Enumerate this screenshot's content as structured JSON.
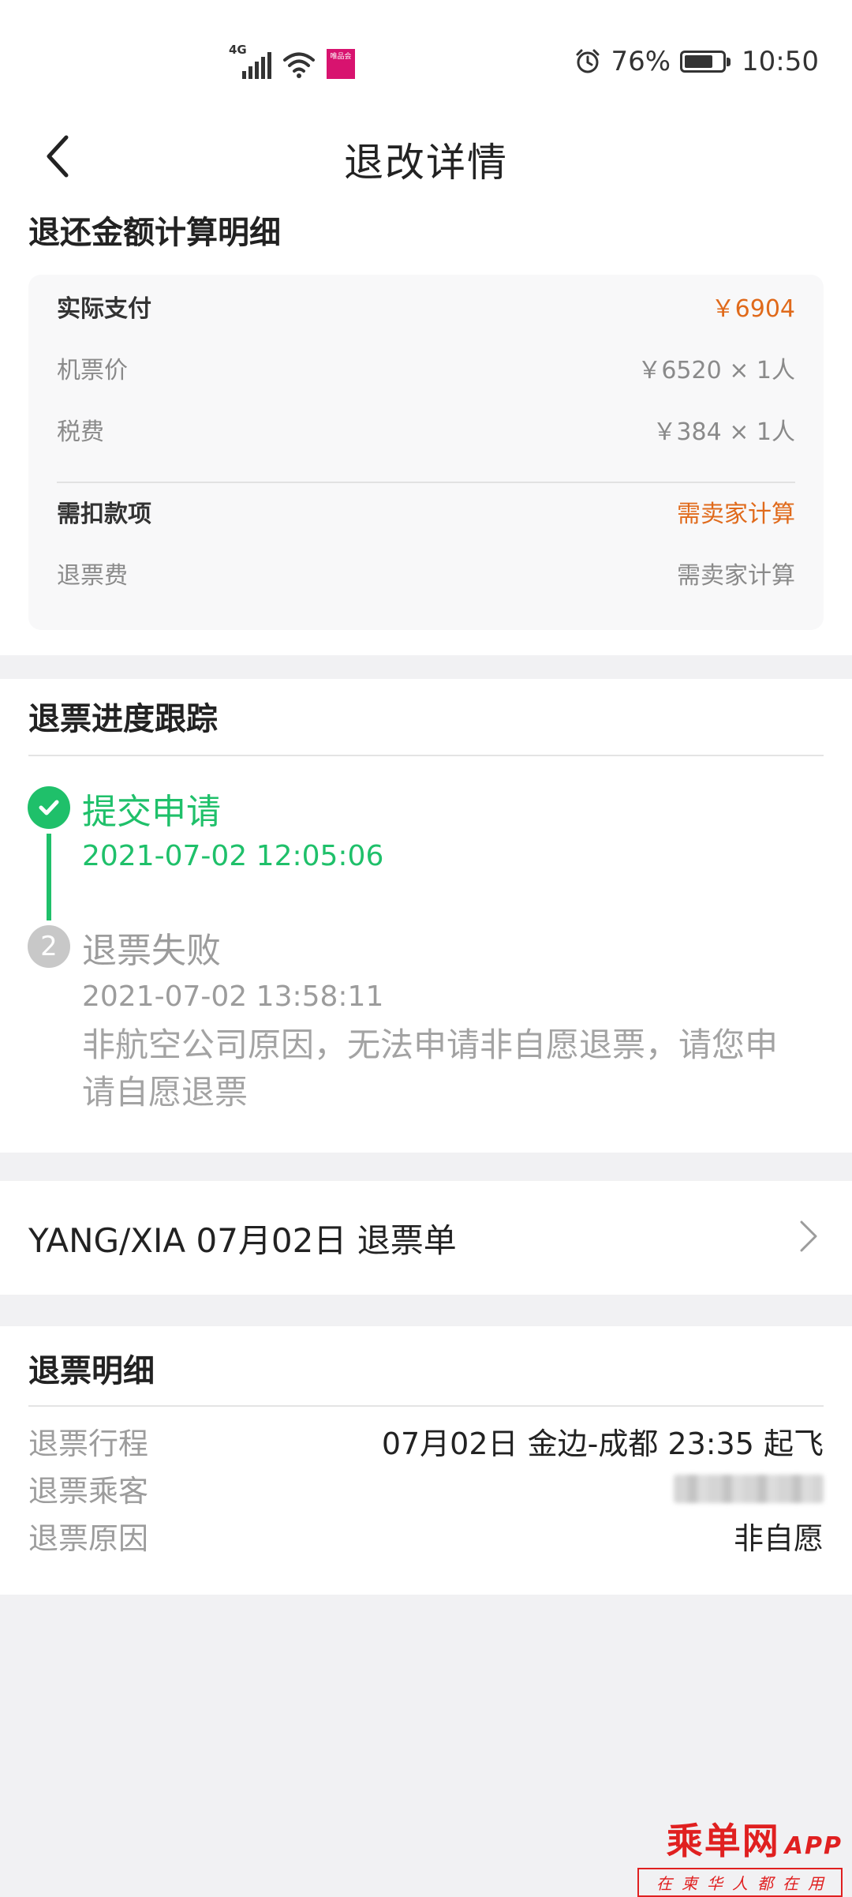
{
  "status_bar": {
    "signal_label": "4G",
    "app_tag": "唯品会",
    "battery_percent": "76%",
    "battery_level": 0.76,
    "time": "10:50"
  },
  "nav": {
    "title": "退改详情"
  },
  "refund_calc": {
    "title": "退还金额计算明细",
    "actual_pay_label": "实际支付",
    "actual_pay_value": "￥6904",
    "ticket_price_label": "机票价",
    "ticket_price_value": "￥6520 × 1人",
    "tax_label": "税费",
    "tax_value": "￥384 × 1人",
    "deduction_label": "需扣款项",
    "deduction_value": "需卖家计算",
    "refund_fee_label": "退票费",
    "refund_fee_value": "需卖家计算"
  },
  "progress": {
    "title": "退票进度跟踪",
    "steps": [
      {
        "title": "提交申请",
        "time": "2021-07-02 12:05:06"
      },
      {
        "number": "2",
        "title": "退票失败",
        "time": "2021-07-02 13:58:11",
        "desc": "非航空公司原因，无法申请非自愿退票，请您申请自愿退票"
      }
    ]
  },
  "order_link": {
    "text": "YANG/XIA 07月02日 退票单"
  },
  "details": {
    "title": "退票明细",
    "itinerary_label": "退票行程",
    "itinerary_value": "07月02日 金边-成都 23:35 起飞",
    "passenger_label": "退票乘客",
    "reason_label": "退票原因",
    "reason_value": "非自愿"
  },
  "watermark": {
    "brand": "乘单网",
    "app": "APP",
    "slogan": "在柬华人都在用"
  },
  "colors": {
    "accent_orange": "#e06a1b",
    "success_green": "#1fc06a",
    "watermark_red": "#e02020"
  }
}
